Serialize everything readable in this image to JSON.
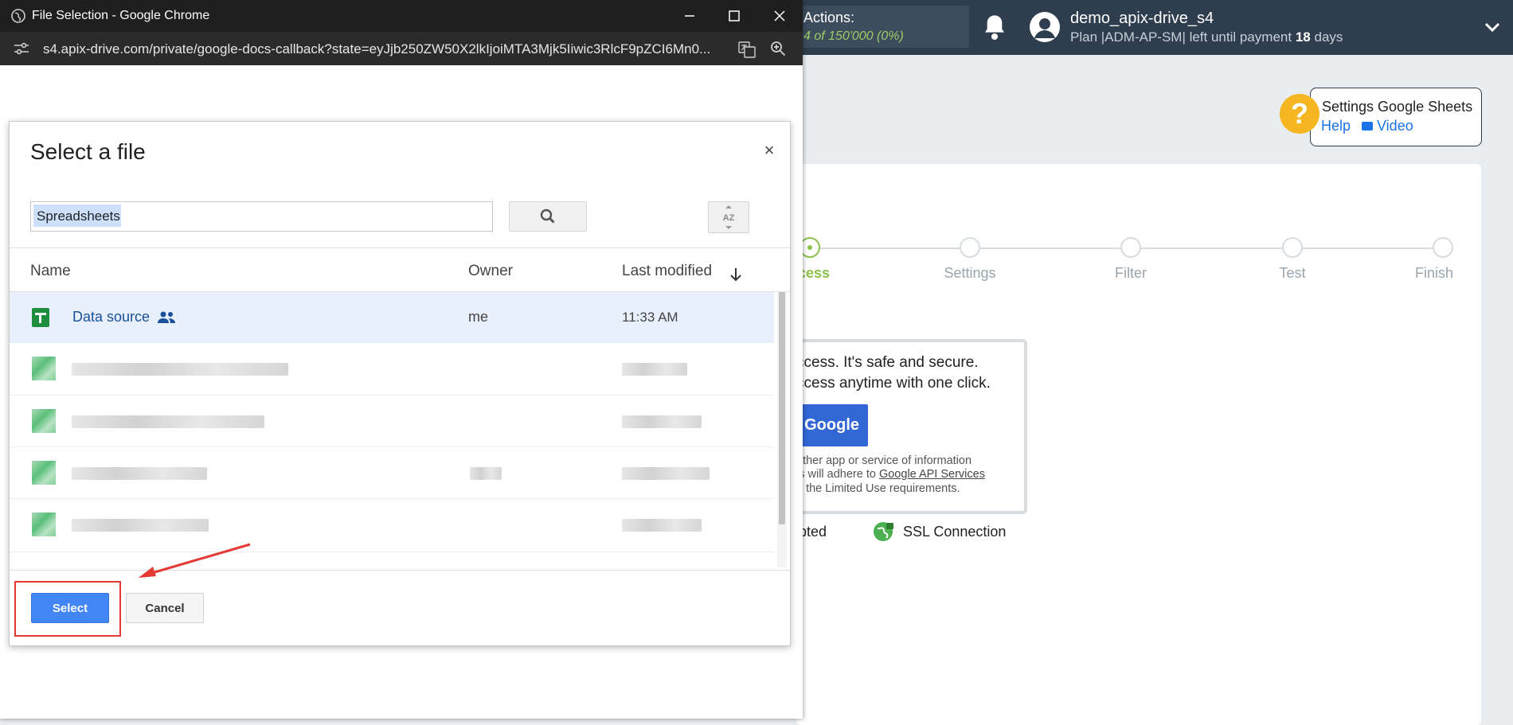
{
  "app": {
    "actions_title": "Actions:",
    "actions_count": "4 of 150'000 (0%)",
    "user_name": "demo_apix-drive_s4",
    "plan_prefix": "Plan |ADM-AP-SM| left until payment",
    "plan_days": "18",
    "plan_suffix": "days",
    "help_title": "Settings Google Sheets",
    "help_link": "Help",
    "video_link": "Video",
    "steps": [
      {
        "label": "cess",
        "state": "active"
      },
      {
        "label": "Settings",
        "state": "inactive"
      },
      {
        "label": "Filter",
        "state": "inactive"
      },
      {
        "label": "Test",
        "state": "inactive"
      },
      {
        "label": "Finish",
        "state": "inactive"
      }
    ],
    "auth_line_1": "ccess. It's safe and secure.",
    "auth_line_2": "ccess anytime with one click.",
    "google_button": "Google",
    "auth_small_1": "other app or service of information",
    "auth_small_2_prefix": "ls will adhere to",
    "auth_small_2_link": "Google API Services",
    "auth_small_3": "g the Limited Use requirements.",
    "encrypted_label": "pted",
    "ssl_label": "SSL Connection"
  },
  "chrome": {
    "title": "File Selection - Google Chrome",
    "url": "s4.apix-drive.com/private/google-docs-callback?state=eyJjb250ZW50X2lkIjoiMTA3Mjk5Iiwic3RlcF9pZCI6Mn0..."
  },
  "picker": {
    "title": "Select a file",
    "search_value": "Spreadsheets",
    "columns": {
      "name": "Name",
      "owner": "Owner",
      "modified": "Last modified"
    },
    "files": [
      {
        "name": "Data source",
        "owner": "me",
        "modified": "11:33 AM",
        "shared": true,
        "selected": true
      }
    ],
    "select_button": "Select",
    "cancel_button": "Cancel"
  },
  "colors": {
    "header_bg": "#2f3e4e",
    "accent_green": "#8bc34a",
    "google_blue": "#4285f4",
    "annotation_red": "#e53935"
  }
}
